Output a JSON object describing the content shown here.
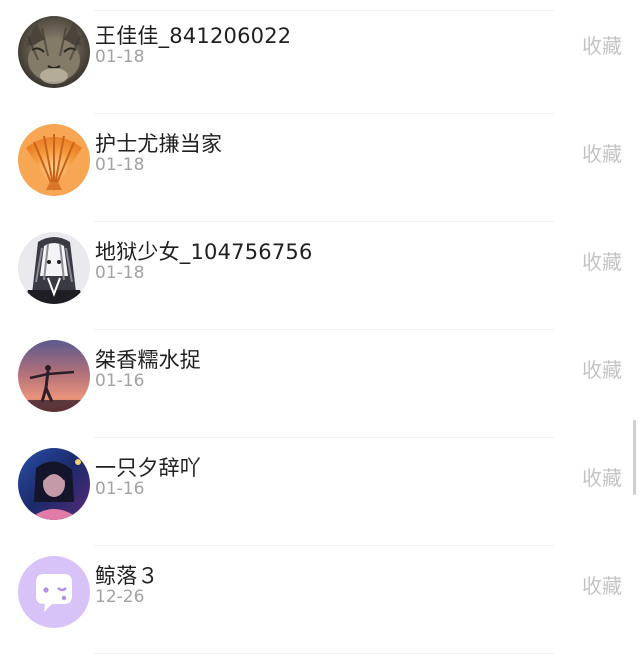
{
  "friends": [
    {
      "name": "王佳佳_841206022",
      "date": "01-18",
      "action": "收藏",
      "avatar_icon": "cat-avatar-icon"
    },
    {
      "name": "护士尤搛当家",
      "date": "01-18",
      "action": "收藏",
      "avatar_icon": "seashell-avatar-icon"
    },
    {
      "name": "地狱少女_104756756",
      "date": "01-18",
      "action": "收藏",
      "avatar_icon": "anime-girl-avatar-icon"
    },
    {
      "name": "桀香糯水捉",
      "date": "01-16",
      "action": "收藏",
      "avatar_icon": "sunset-silhouette-avatar-icon"
    },
    {
      "name": "一只夕辞吖",
      "date": "01-16",
      "action": "收藏",
      "avatar_icon": "night-portrait-avatar-icon"
    },
    {
      "name": "鲸落３",
      "date": "12-26",
      "action": "收藏",
      "avatar_icon": "chat-bubble-avatar-icon"
    }
  ],
  "colors": {
    "name_text": "#1f1f1f",
    "date_text": "#a2a2a2",
    "action_text": "#c4c4c4",
    "chat_avatar_bg": "#d7c3f7"
  }
}
